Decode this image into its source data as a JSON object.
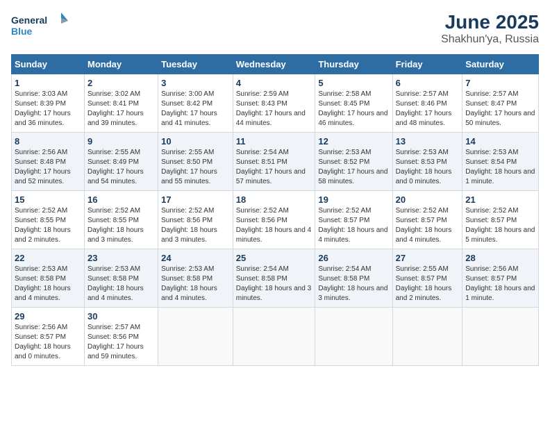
{
  "logo": {
    "line1": "General",
    "line2": "Blue"
  },
  "title": "June 2025",
  "subtitle": "Shakhun'ya, Russia",
  "days_header": [
    "Sunday",
    "Monday",
    "Tuesday",
    "Wednesday",
    "Thursday",
    "Friday",
    "Saturday"
  ],
  "weeks": [
    [
      {
        "day": "1",
        "sunrise": "Sunrise: 3:03 AM",
        "sunset": "Sunset: 8:39 PM",
        "daylight": "Daylight: 17 hours and 36 minutes."
      },
      {
        "day": "2",
        "sunrise": "Sunrise: 3:02 AM",
        "sunset": "Sunset: 8:41 PM",
        "daylight": "Daylight: 17 hours and 39 minutes."
      },
      {
        "day": "3",
        "sunrise": "Sunrise: 3:00 AM",
        "sunset": "Sunset: 8:42 PM",
        "daylight": "Daylight: 17 hours and 41 minutes."
      },
      {
        "day": "4",
        "sunrise": "Sunrise: 2:59 AM",
        "sunset": "Sunset: 8:43 PM",
        "daylight": "Daylight: 17 hours and 44 minutes."
      },
      {
        "day": "5",
        "sunrise": "Sunrise: 2:58 AM",
        "sunset": "Sunset: 8:45 PM",
        "daylight": "Daylight: 17 hours and 46 minutes."
      },
      {
        "day": "6",
        "sunrise": "Sunrise: 2:57 AM",
        "sunset": "Sunset: 8:46 PM",
        "daylight": "Daylight: 17 hours and 48 minutes."
      },
      {
        "day": "7",
        "sunrise": "Sunrise: 2:57 AM",
        "sunset": "Sunset: 8:47 PM",
        "daylight": "Daylight: 17 hours and 50 minutes."
      }
    ],
    [
      {
        "day": "8",
        "sunrise": "Sunrise: 2:56 AM",
        "sunset": "Sunset: 8:48 PM",
        "daylight": "Daylight: 17 hours and 52 minutes."
      },
      {
        "day": "9",
        "sunrise": "Sunrise: 2:55 AM",
        "sunset": "Sunset: 8:49 PM",
        "daylight": "Daylight: 17 hours and 54 minutes."
      },
      {
        "day": "10",
        "sunrise": "Sunrise: 2:55 AM",
        "sunset": "Sunset: 8:50 PM",
        "daylight": "Daylight: 17 hours and 55 minutes."
      },
      {
        "day": "11",
        "sunrise": "Sunrise: 2:54 AM",
        "sunset": "Sunset: 8:51 PM",
        "daylight": "Daylight: 17 hours and 57 minutes."
      },
      {
        "day": "12",
        "sunrise": "Sunrise: 2:53 AM",
        "sunset": "Sunset: 8:52 PM",
        "daylight": "Daylight: 17 hours and 58 minutes."
      },
      {
        "day": "13",
        "sunrise": "Sunrise: 2:53 AM",
        "sunset": "Sunset: 8:53 PM",
        "daylight": "Daylight: 18 hours and 0 minutes."
      },
      {
        "day": "14",
        "sunrise": "Sunrise: 2:53 AM",
        "sunset": "Sunset: 8:54 PM",
        "daylight": "Daylight: 18 hours and 1 minute."
      }
    ],
    [
      {
        "day": "15",
        "sunrise": "Sunrise: 2:52 AM",
        "sunset": "Sunset: 8:55 PM",
        "daylight": "Daylight: 18 hours and 2 minutes."
      },
      {
        "day": "16",
        "sunrise": "Sunrise: 2:52 AM",
        "sunset": "Sunset: 8:55 PM",
        "daylight": "Daylight: 18 hours and 3 minutes."
      },
      {
        "day": "17",
        "sunrise": "Sunrise: 2:52 AM",
        "sunset": "Sunset: 8:56 PM",
        "daylight": "Daylight: 18 hours and 3 minutes."
      },
      {
        "day": "18",
        "sunrise": "Sunrise: 2:52 AM",
        "sunset": "Sunset: 8:56 PM",
        "daylight": "Daylight: 18 hours and 4 minutes."
      },
      {
        "day": "19",
        "sunrise": "Sunrise: 2:52 AM",
        "sunset": "Sunset: 8:57 PM",
        "daylight": "Daylight: 18 hours and 4 minutes."
      },
      {
        "day": "20",
        "sunrise": "Sunrise: 2:52 AM",
        "sunset": "Sunset: 8:57 PM",
        "daylight": "Daylight: 18 hours and 4 minutes."
      },
      {
        "day": "21",
        "sunrise": "Sunrise: 2:52 AM",
        "sunset": "Sunset: 8:57 PM",
        "daylight": "Daylight: 18 hours and 5 minutes."
      }
    ],
    [
      {
        "day": "22",
        "sunrise": "Sunrise: 2:53 AM",
        "sunset": "Sunset: 8:58 PM",
        "daylight": "Daylight: 18 hours and 4 minutes."
      },
      {
        "day": "23",
        "sunrise": "Sunrise: 2:53 AM",
        "sunset": "Sunset: 8:58 PM",
        "daylight": "Daylight: 18 hours and 4 minutes."
      },
      {
        "day": "24",
        "sunrise": "Sunrise: 2:53 AM",
        "sunset": "Sunset: 8:58 PM",
        "daylight": "Daylight: 18 hours and 4 minutes."
      },
      {
        "day": "25",
        "sunrise": "Sunrise: 2:54 AM",
        "sunset": "Sunset: 8:58 PM",
        "daylight": "Daylight: 18 hours and 3 minutes."
      },
      {
        "day": "26",
        "sunrise": "Sunrise: 2:54 AM",
        "sunset": "Sunset: 8:58 PM",
        "daylight": "Daylight: 18 hours and 3 minutes."
      },
      {
        "day": "27",
        "sunrise": "Sunrise: 2:55 AM",
        "sunset": "Sunset: 8:57 PM",
        "daylight": "Daylight: 18 hours and 2 minutes."
      },
      {
        "day": "28",
        "sunrise": "Sunrise: 2:56 AM",
        "sunset": "Sunset: 8:57 PM",
        "daylight": "Daylight: 18 hours and 1 minute."
      }
    ],
    [
      {
        "day": "29",
        "sunrise": "Sunrise: 2:56 AM",
        "sunset": "Sunset: 8:57 PM",
        "daylight": "Daylight: 18 hours and 0 minutes."
      },
      {
        "day": "30",
        "sunrise": "Sunrise: 2:57 AM",
        "sunset": "Sunset: 8:56 PM",
        "daylight": "Daylight: 17 hours and 59 minutes."
      },
      null,
      null,
      null,
      null,
      null
    ]
  ]
}
